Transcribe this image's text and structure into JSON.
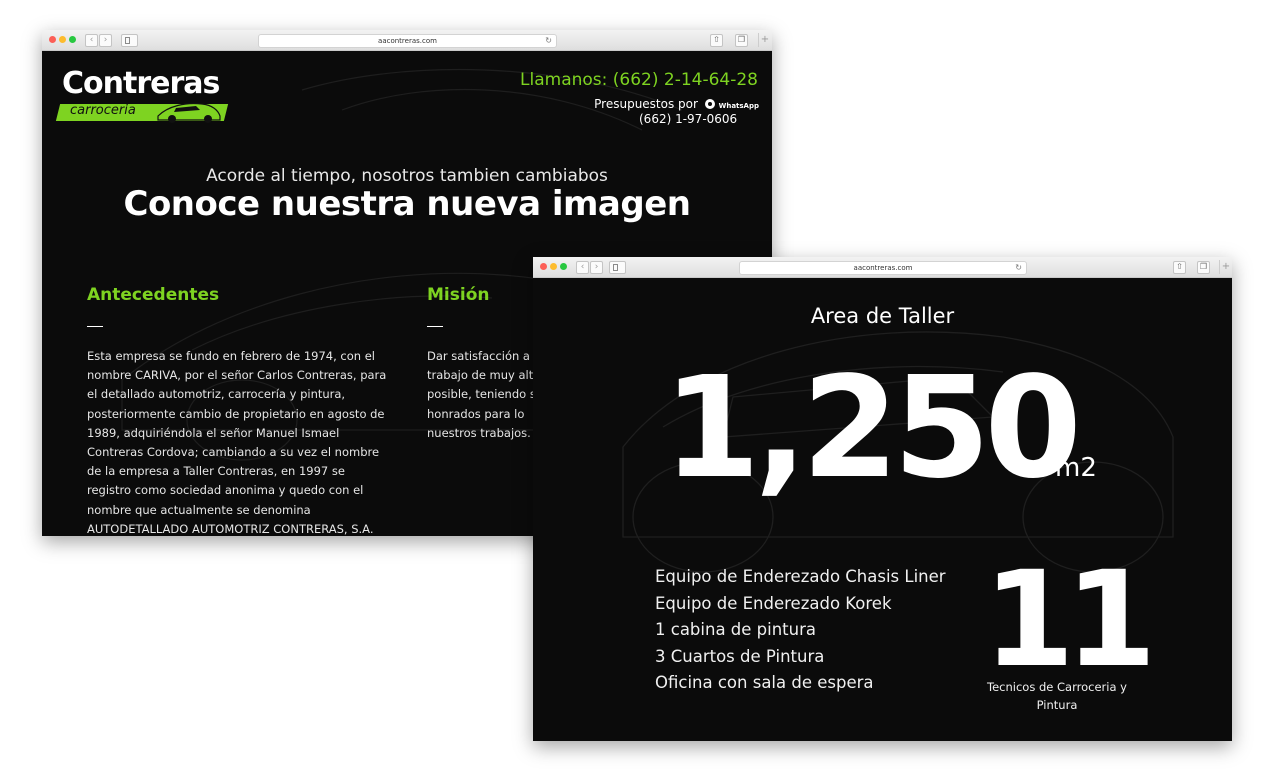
{
  "colors": {
    "accent": "#7ed321",
    "background": "#0b0b0b",
    "text": "#ffffff"
  },
  "window1": {
    "url": "aacontreras.com",
    "logo": {
      "word": "Contreras",
      "sub": "carroceria"
    },
    "phone": "Llamanos: (662) 2-14-64-28",
    "quote_prefix": "Presupuestos por",
    "quote_brand": "WhatsApp",
    "whatsapp_number": "(662) 1-97-0606",
    "tagline": "Acorde al tiempo, nosotros tambien cambiabos",
    "headline": "Conoce nuestra nueva imagen",
    "sections": [
      {
        "title": "Antecedentes",
        "body": "Esta empresa se fundo en febrero de 1974, con el nombre CARIVA, por el señor Carlos Contreras, para el detallado automotriz, carrocería y pintura, posteriormente cambio de propietario en agosto de 1989, adquiriéndola el señor Manuel Ismael Contreras Cordova; cambiando a su vez el nombre de la empresa a Taller Contreras, en 1997 se registro como sociedad anonima y quedo con el nombre que actualmente se denomina AUTODETALLADO AUTOMOTRIZ CONTRERAS, S.A. DE C.V."
      },
      {
        "title": "Misión",
        "body": "Dar satisfacción a trabajo de muy alt posible, teniendo s y honrados para lo nuestros trabajos."
      }
    ]
  },
  "window2": {
    "url": "aacontreras.com",
    "title": "Area de Taller",
    "area_value": "1,250",
    "area_unit": "m2",
    "equipment": [
      "Equipo de Enderezado Chasis Liner",
      "Equipo de Enderezado Korek",
      "1 cabina de pintura",
      "3 Cuartos de Pintura",
      "Oficina con sala de espera"
    ],
    "technicians_count": "11",
    "technicians_label": "Tecnicos de Carroceria y Pintura"
  }
}
